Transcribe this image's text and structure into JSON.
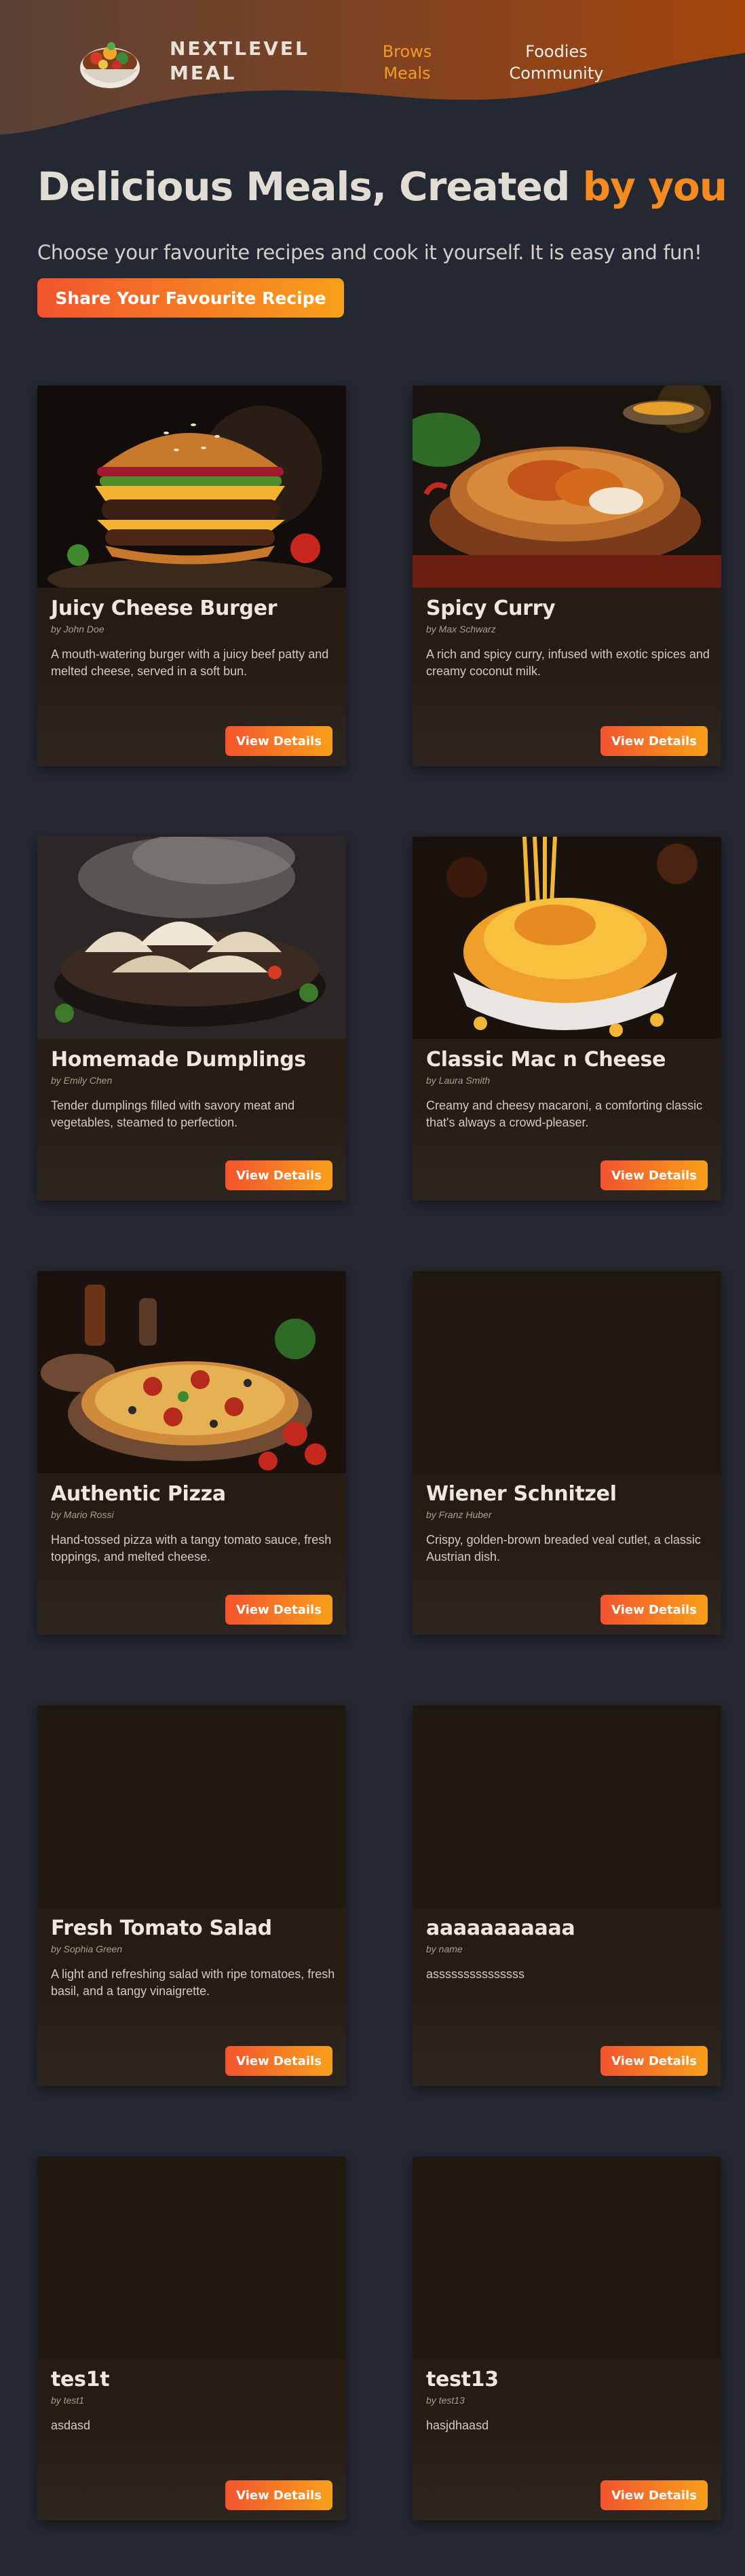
{
  "header": {
    "logo_icon": "food-bowl-logo",
    "brand_line1": "NEXTLEVEL",
    "brand_line2": "MEAL",
    "nav_browse_line1": "Brows",
    "nav_browse_line2": "Meals",
    "nav_foodies_line1": "Foodies",
    "nav_foodies_line2": "Community",
    "active_color": "#f59a23"
  },
  "hero": {
    "title_main": "Delicious Meals, Created ",
    "title_accent": "by you",
    "subtitle": "Choose your favourite recipes and cook it yourself. It is easy and fun!",
    "cta_label": "Share Your Favourite Recipe",
    "accent_color": "#f58b20"
  },
  "button_gradient": [
    "#f2542e",
    "#f8a01a"
  ],
  "meals": [
    {
      "title": "Juicy Cheese Burger",
      "author": "by John Doe",
      "description": "A mouth-watering burger with a juicy beef patty and melted cheese, served in a soft bun.",
      "button": "View Details",
      "image": "burger"
    },
    {
      "title": "Spicy Curry",
      "author": "by Max Schwarz",
      "description": "A rich and spicy curry, infused with exotic spices and creamy coconut milk.",
      "button": "View Details",
      "image": "curry"
    },
    {
      "title": "Homemade Dumplings",
      "author": "by Emily Chen",
      "description": "Tender dumplings filled with savory meat and vegetables, steamed to perfection.",
      "button": "View Details",
      "image": "dumplings"
    },
    {
      "title": "Classic Mac n Cheese",
      "author": "by Laura Smith",
      "description": "Creamy and cheesy macaroni, a comforting classic that's always a crowd-pleaser.",
      "button": "View Details",
      "image": "mac"
    },
    {
      "title": "Authentic Pizza",
      "author": "by Mario Rossi",
      "description": "Hand-tossed pizza with a tangy tomato sauce, fresh toppings, and melted cheese.",
      "button": "View Details",
      "image": "pizza"
    },
    {
      "title": "Wiener Schnitzel",
      "author": "by Franz Huber",
      "description": "Crispy, golden-brown breaded veal cutlet, a classic Austrian dish.",
      "button": "View Details",
      "image": "none"
    },
    {
      "title": "Fresh Tomato Salad",
      "author": "by Sophia Green",
      "description": "A light and refreshing salad with ripe tomatoes, fresh basil, and a tangy vinaigrette.",
      "button": "View Details",
      "image": "none"
    },
    {
      "title": "aaaaaaaaaaa",
      "author": "by name",
      "description": "asssssssssssssss",
      "button": "View Details",
      "image": "none"
    },
    {
      "title": "tes1t",
      "author": "by test1",
      "description": "asdasd",
      "button": "View Details",
      "image": "none"
    },
    {
      "title": "test13",
      "author": "by test13",
      "description": "hasjdhaasd",
      "button": "View Details",
      "image": "none"
    }
  ]
}
